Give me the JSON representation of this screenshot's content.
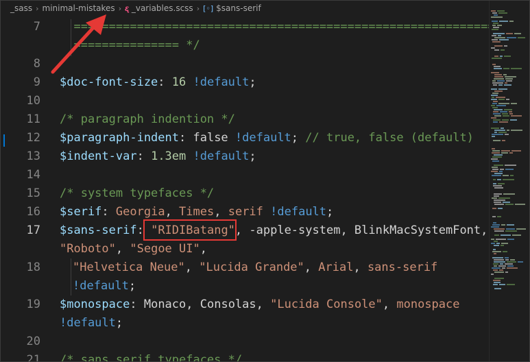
{
  "breadcrumb": {
    "items": [
      "_sass",
      "minimal-mistakes",
      "_variables.scss",
      "$sans-serif"
    ],
    "file_icon": "sass-file-icon",
    "symbol_icon": "variable-symbol-icon"
  },
  "line_numbers": [
    "7",
    "8",
    "9",
    "10",
    "11",
    "12",
    "13",
    "14",
    "15",
    "16",
    "17",
    "18",
    "19",
    "20",
    "21"
  ],
  "active_line": "17",
  "code": {
    "l7a": "  ========================================================================",
    "l7b": "  =============== */",
    "l9_var": "$doc-font-size",
    "l9_colon": ": ",
    "l9_num": "16",
    "l9_kw": " !default",
    "l9_end": ";",
    "l11": "/* paragraph indention */",
    "l12_var": "$paragraph-indent",
    "l12_colon": ": ",
    "l12_val": "false",
    "l12_kw": " !default",
    "l12_end": "; ",
    "l12_cm": "// true, false (default)",
    "l13_var": "$indent-var",
    "l13_colon": ": ",
    "l13_num": "1.3em",
    "l13_kw": " !default",
    "l13_end": ";",
    "l15": "/* system typefaces */",
    "l16_var": "$serif",
    "l16_colon": ": ",
    "l16_s1": "Georgia",
    "l16_c1": ", ",
    "l16_s2": "Times",
    "l16_c2": ", ",
    "l16_s3": "serif",
    "l16_kw": " !default",
    "l16_end": ";",
    "l17_var": "$sans-serif",
    "l17_colon": ": ",
    "l17_q1": "\"RIDIBat",
    "l17_sel": "",
    "l17_q2": "ang\"",
    "l17_rest": ", -apple-system, BlinkMacSystemFont,",
    "l17b_s1": "\"Roboto\"",
    "l17b_c": ", ",
    "l17b_s2": "\"Segoe UI\"",
    "l17b_end": ",",
    "l18a_s1": "\"Helvetica Neue\"",
    "l18a_c1": ", ",
    "l18a_s2": "\"Lucida Grande\"",
    "l18a_c2": ", ",
    "l18a_s3": "Arial",
    "l18a_c3": ", ",
    "l18a_s4": "sans-serif",
    "l18b_kw": "!default",
    "l18b_end": ";",
    "l19_var": "$monospace",
    "l19_colon": ": ",
    "l19_v1": "Monaco",
    "l19_c1": ", ",
    "l19_v2": "Consolas",
    "l19_c2": ", ",
    "l19_s1": "\"Lucida Console\"",
    "l19_c3": ", ",
    "l19_s2": "monospace",
    "l19b_kw": "!default",
    "l19b_end": ";",
    "l21": "/* sans serif typefaces */"
  },
  "colors": {
    "comment": "#6a9955",
    "variable": "#9cdcfe",
    "keyword": "#569cd6",
    "number": "#b5cea8",
    "string": "#ce9178",
    "annotation": "#e53935"
  }
}
